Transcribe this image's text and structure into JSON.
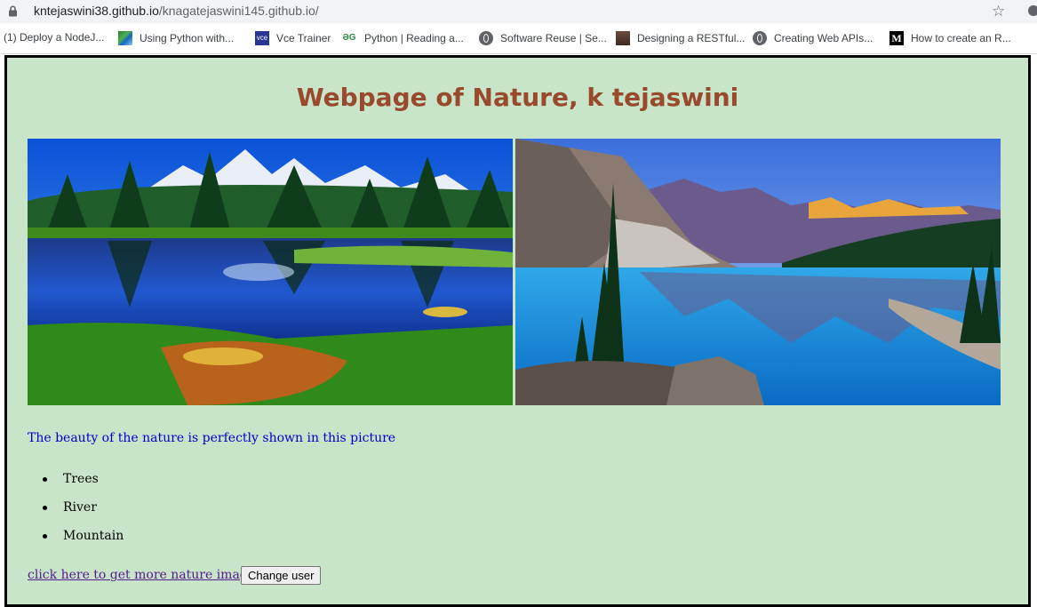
{
  "browser": {
    "url_domain": "kntejaswini38.github.io",
    "url_path": "/knagatejaswini145.github.io/",
    "icons": {
      "lock": "lock-icon",
      "star": "star-icon"
    }
  },
  "bookmarks": [
    {
      "label": "(1) Deploy a NodeJ...",
      "icon": "none"
    },
    {
      "label": "Using Python with...",
      "icon": "python-icon"
    },
    {
      "label": "Vce Trainer",
      "icon": "vce-icon"
    },
    {
      "label": "Python | Reading a...",
      "icon": "gfg-icon"
    },
    {
      "label": "Software Reuse | Se...",
      "icon": "globe-icon"
    },
    {
      "label": "Designing a RESTful...",
      "icon": "photo-icon"
    },
    {
      "label": "Creating Web APIs...",
      "icon": "globe-icon"
    },
    {
      "label": "How to create an R...",
      "icon": "medium-icon"
    }
  ],
  "page": {
    "title": "Webpage of Nature, k tejaswini",
    "caption": "The beauty of the nature is perfectly shown in this picture",
    "list": [
      "Trees",
      "River",
      "Mountain"
    ],
    "link_text": "click here to get more nature images",
    "button_label": "Change user",
    "images": [
      "nature-lake-forest-image",
      "mountain-lake-image"
    ]
  },
  "colors": {
    "page_background": "#c8e4c9",
    "title": "#9a4a2c",
    "caption": "#0000cc",
    "link_visited": "#551a8b"
  }
}
